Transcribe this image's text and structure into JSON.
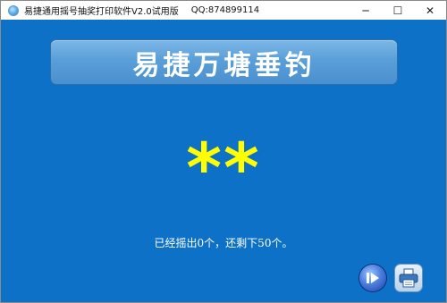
{
  "window": {
    "title": "易捷通用摇号抽奖打印软件V2.0试用版",
    "qq": "QQ:874899114",
    "minimize_glyph": "─",
    "maximize_glyph": "☐",
    "close_glyph": "✕"
  },
  "banner": {
    "text": "易捷万塘垂钓"
  },
  "draw": {
    "result": "**"
  },
  "status": {
    "text": "已经摇出0个，还剩下50个。"
  },
  "toolbar": {
    "play_icon": "play-icon",
    "print_icon": "printer-icon"
  },
  "colors": {
    "background": "#0d71c7",
    "banner": "#5a9fd9",
    "result": "#ffff00",
    "status_text": "#ffffff"
  }
}
